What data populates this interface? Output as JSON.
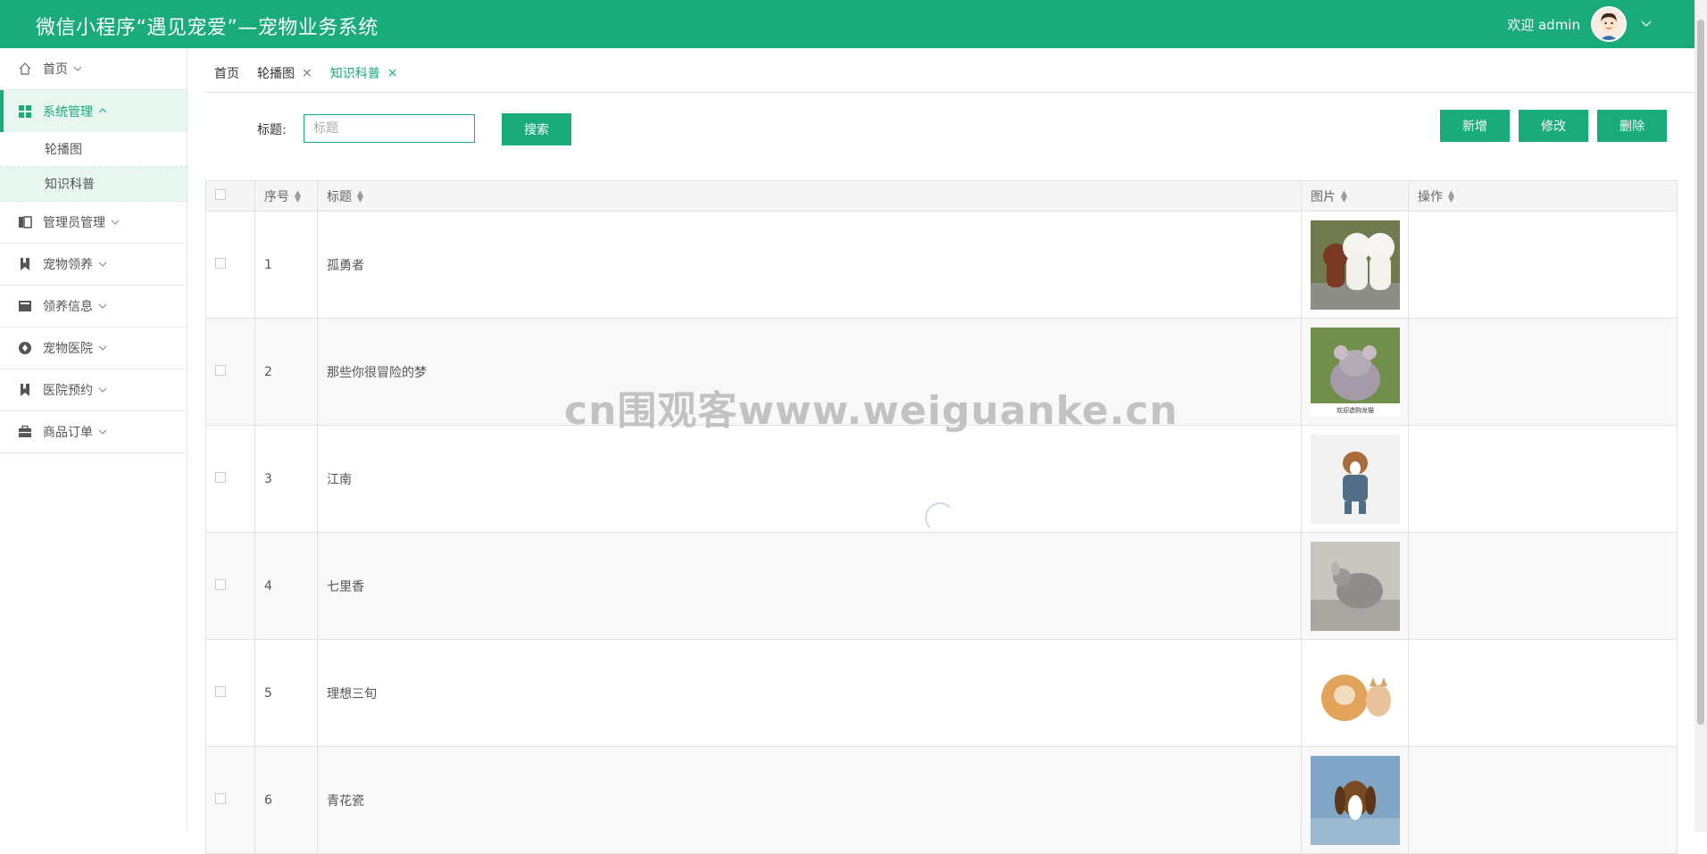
{
  "header": {
    "title": "微信小程序“遇见宠爱”—宠物业务系统",
    "welcome": "欢迎 admin",
    "bg_color": "#1aab7a"
  },
  "sidebar": {
    "items": [
      {
        "label": "首页",
        "icon": "home-icon"
      },
      {
        "label": "系统管理",
        "icon": "grid-icon",
        "expanded": true,
        "children": [
          {
            "label": "轮播图"
          },
          {
            "label": "知识科普",
            "selected": true
          }
        ]
      },
      {
        "label": "管理员管理",
        "icon": "columns-icon"
      },
      {
        "label": "宠物领养",
        "icon": "bookmark-icon"
      },
      {
        "label": "领养信息",
        "icon": "card-icon"
      },
      {
        "label": "宠物医院",
        "icon": "circle-icon"
      },
      {
        "label": "医院预约",
        "icon": "bookmark-icon"
      },
      {
        "label": "商品订单",
        "icon": "briefcase-icon"
      }
    ]
  },
  "tabs": [
    {
      "label": "首页",
      "closable": false
    },
    {
      "label": "轮播图",
      "closable": true
    },
    {
      "label": "知识科普",
      "closable": true,
      "active": true
    }
  ],
  "tab_close_glyph": "×",
  "search": {
    "label": "标题:",
    "placeholder": "标题",
    "value": "",
    "button": "搜索"
  },
  "actions": {
    "add": "新增",
    "edit": "修改",
    "delete": "删除"
  },
  "table": {
    "columns": [
      "序号",
      "标题",
      "图片",
      "操作"
    ],
    "rows": [
      {
        "index": "1",
        "title": "孤勇者",
        "image": "two-poodles-photo"
      },
      {
        "index": "2",
        "title": "那些你很冒险的梦",
        "image": "chinchilla-photo",
        "caption": "欢迎选购龙猫"
      },
      {
        "index": "3",
        "title": "江南",
        "image": "beagle-in-shirt-photo"
      },
      {
        "index": "4",
        "title": "七里香",
        "image": "chinchilla-grey-photo"
      },
      {
        "index": "5",
        "title": "理想三旬",
        "image": "pomeranian-and-cat-photo"
      },
      {
        "index": "6",
        "title": "青花瓷",
        "image": "basset-hound-photo"
      }
    ]
  },
  "watermark": "cn围观客www.weiguanke.cn",
  "accent_color": "#1aab7a"
}
